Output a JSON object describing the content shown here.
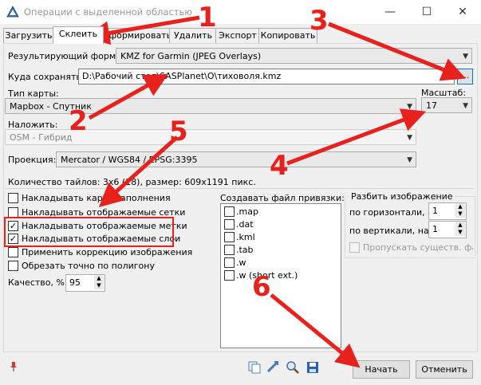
{
  "window": {
    "title": "Операции с выделенной областью",
    "minimize": "—",
    "maximize": "☐",
    "close": "✕"
  },
  "tabs": [
    {
      "label": "Загрузить"
    },
    {
      "label": "Склеить"
    },
    {
      "label": "Сформировать"
    },
    {
      "label": "Удалить"
    },
    {
      "label": "Экспорт"
    },
    {
      "label": "Копировать"
    }
  ],
  "form": {
    "result_format_label": "Результирующий формат:",
    "result_format_value": "KMZ for Garmin (JPEG Overlays)",
    "save_to_label": "Куда сохранять:",
    "save_to_value": "D:\\Рабочий стол\\SASPlanet\\О\\тиховоля.kmz",
    "browse_label": "...",
    "map_type_label": "Тип карты:",
    "map_type_value": "Mapbox - Спутник",
    "scale_label": "Масштаб:",
    "scale_value": "17",
    "overlay_label": "Наложить:",
    "overlay_value": "OSM - Гибрид",
    "projection_label": "Проекция:",
    "projection_value": "Mercator / WGS84 / EPSG:3395",
    "tiles_info": "Количество тайлов: 3x6 (18), размер: 609x1191 пикс."
  },
  "options": [
    {
      "label": "Накладывать карту заполнения",
      "checked": false
    },
    {
      "label": "Накладывать отображаемые сетки",
      "checked": false
    },
    {
      "label": "Накладывать отображаемые метки",
      "checked": true
    },
    {
      "label": "Накладывать отображаемые слои",
      "checked": true
    },
    {
      "label": "Применить коррекцию изображения",
      "checked": false
    },
    {
      "label": "Обрезать точно по полигону",
      "checked": false
    }
  ],
  "quality": {
    "label": "Качество, %",
    "value": "95"
  },
  "binding": {
    "label": "Создавать файл привязки:",
    "items": [
      ".map",
      ".dat",
      ".kml",
      ".tab",
      ".w",
      ".w (short ext.)"
    ]
  },
  "split": {
    "label": "Разбить изображение",
    "horizontal_label": "по горизонтали, на",
    "horizontal_value": "1",
    "vertical_label": "по вертикали, на",
    "vertical_value": "1",
    "skip_label": "Пропускать существ. файл"
  },
  "buttons": {
    "start": "Начать",
    "cancel": "Отменить"
  },
  "annotations": [
    "1",
    "2",
    "3",
    "4",
    "5",
    "6"
  ],
  "colors": {
    "annotation": "#e8211c",
    "accent": "#0078d7"
  }
}
